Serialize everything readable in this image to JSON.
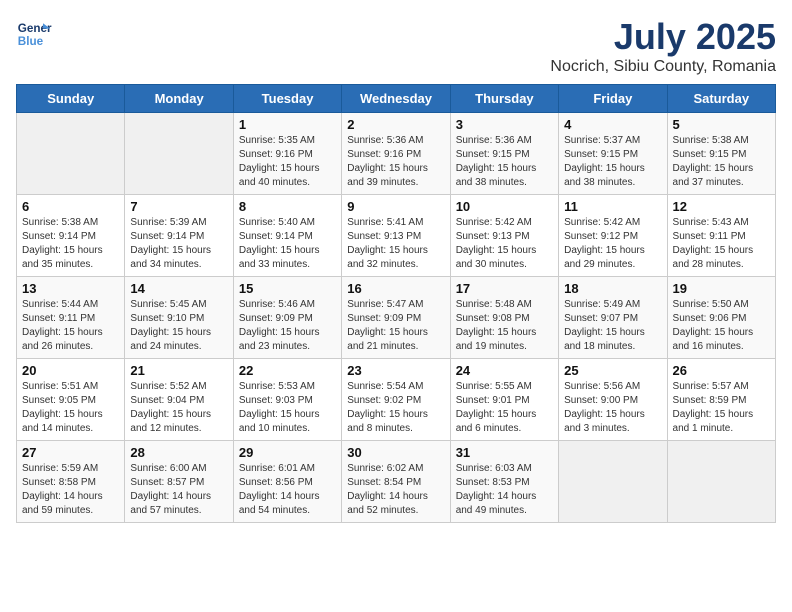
{
  "logo": {
    "line1": "General",
    "line2": "Blue"
  },
  "title": "July 2025",
  "subtitle": "Nocrich, Sibiu County, Romania",
  "days_header": [
    "Sunday",
    "Monday",
    "Tuesday",
    "Wednesday",
    "Thursday",
    "Friday",
    "Saturday"
  ],
  "weeks": [
    [
      {
        "day": "",
        "info": ""
      },
      {
        "day": "",
        "info": ""
      },
      {
        "day": "1",
        "info": "Sunrise: 5:35 AM\nSunset: 9:16 PM\nDaylight: 15 hours\nand 40 minutes."
      },
      {
        "day": "2",
        "info": "Sunrise: 5:36 AM\nSunset: 9:16 PM\nDaylight: 15 hours\nand 39 minutes."
      },
      {
        "day": "3",
        "info": "Sunrise: 5:36 AM\nSunset: 9:15 PM\nDaylight: 15 hours\nand 38 minutes."
      },
      {
        "day": "4",
        "info": "Sunrise: 5:37 AM\nSunset: 9:15 PM\nDaylight: 15 hours\nand 38 minutes."
      },
      {
        "day": "5",
        "info": "Sunrise: 5:38 AM\nSunset: 9:15 PM\nDaylight: 15 hours\nand 37 minutes."
      }
    ],
    [
      {
        "day": "6",
        "info": "Sunrise: 5:38 AM\nSunset: 9:14 PM\nDaylight: 15 hours\nand 35 minutes."
      },
      {
        "day": "7",
        "info": "Sunrise: 5:39 AM\nSunset: 9:14 PM\nDaylight: 15 hours\nand 34 minutes."
      },
      {
        "day": "8",
        "info": "Sunrise: 5:40 AM\nSunset: 9:14 PM\nDaylight: 15 hours\nand 33 minutes."
      },
      {
        "day": "9",
        "info": "Sunrise: 5:41 AM\nSunset: 9:13 PM\nDaylight: 15 hours\nand 32 minutes."
      },
      {
        "day": "10",
        "info": "Sunrise: 5:42 AM\nSunset: 9:13 PM\nDaylight: 15 hours\nand 30 minutes."
      },
      {
        "day": "11",
        "info": "Sunrise: 5:42 AM\nSunset: 9:12 PM\nDaylight: 15 hours\nand 29 minutes."
      },
      {
        "day": "12",
        "info": "Sunrise: 5:43 AM\nSunset: 9:11 PM\nDaylight: 15 hours\nand 28 minutes."
      }
    ],
    [
      {
        "day": "13",
        "info": "Sunrise: 5:44 AM\nSunset: 9:11 PM\nDaylight: 15 hours\nand 26 minutes."
      },
      {
        "day": "14",
        "info": "Sunrise: 5:45 AM\nSunset: 9:10 PM\nDaylight: 15 hours\nand 24 minutes."
      },
      {
        "day": "15",
        "info": "Sunrise: 5:46 AM\nSunset: 9:09 PM\nDaylight: 15 hours\nand 23 minutes."
      },
      {
        "day": "16",
        "info": "Sunrise: 5:47 AM\nSunset: 9:09 PM\nDaylight: 15 hours\nand 21 minutes."
      },
      {
        "day": "17",
        "info": "Sunrise: 5:48 AM\nSunset: 9:08 PM\nDaylight: 15 hours\nand 19 minutes."
      },
      {
        "day": "18",
        "info": "Sunrise: 5:49 AM\nSunset: 9:07 PM\nDaylight: 15 hours\nand 18 minutes."
      },
      {
        "day": "19",
        "info": "Sunrise: 5:50 AM\nSunset: 9:06 PM\nDaylight: 15 hours\nand 16 minutes."
      }
    ],
    [
      {
        "day": "20",
        "info": "Sunrise: 5:51 AM\nSunset: 9:05 PM\nDaylight: 15 hours\nand 14 minutes."
      },
      {
        "day": "21",
        "info": "Sunrise: 5:52 AM\nSunset: 9:04 PM\nDaylight: 15 hours\nand 12 minutes."
      },
      {
        "day": "22",
        "info": "Sunrise: 5:53 AM\nSunset: 9:03 PM\nDaylight: 15 hours\nand 10 minutes."
      },
      {
        "day": "23",
        "info": "Sunrise: 5:54 AM\nSunset: 9:02 PM\nDaylight: 15 hours\nand 8 minutes."
      },
      {
        "day": "24",
        "info": "Sunrise: 5:55 AM\nSunset: 9:01 PM\nDaylight: 15 hours\nand 6 minutes."
      },
      {
        "day": "25",
        "info": "Sunrise: 5:56 AM\nSunset: 9:00 PM\nDaylight: 15 hours\nand 3 minutes."
      },
      {
        "day": "26",
        "info": "Sunrise: 5:57 AM\nSunset: 8:59 PM\nDaylight: 15 hours\nand 1 minute."
      }
    ],
    [
      {
        "day": "27",
        "info": "Sunrise: 5:59 AM\nSunset: 8:58 PM\nDaylight: 14 hours\nand 59 minutes."
      },
      {
        "day": "28",
        "info": "Sunrise: 6:00 AM\nSunset: 8:57 PM\nDaylight: 14 hours\nand 57 minutes."
      },
      {
        "day": "29",
        "info": "Sunrise: 6:01 AM\nSunset: 8:56 PM\nDaylight: 14 hours\nand 54 minutes."
      },
      {
        "day": "30",
        "info": "Sunrise: 6:02 AM\nSunset: 8:54 PM\nDaylight: 14 hours\nand 52 minutes."
      },
      {
        "day": "31",
        "info": "Sunrise: 6:03 AM\nSunset: 8:53 PM\nDaylight: 14 hours\nand 49 minutes."
      },
      {
        "day": "",
        "info": ""
      },
      {
        "day": "",
        "info": ""
      }
    ]
  ]
}
